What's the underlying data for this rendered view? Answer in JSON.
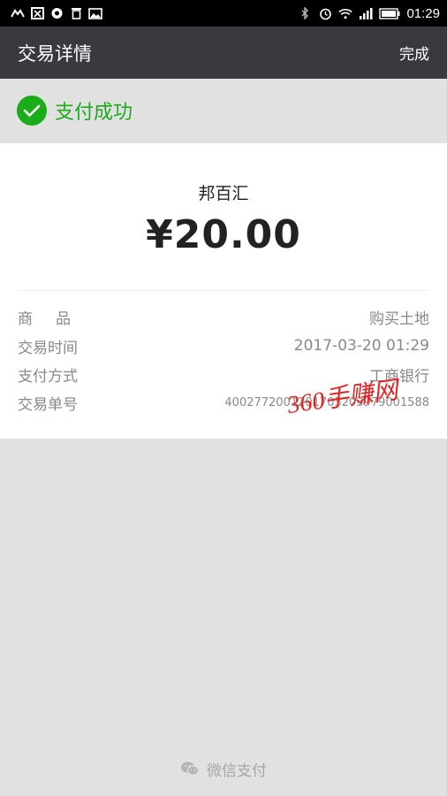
{
  "status_bar": {
    "time": "01:29",
    "left_icons": [
      "missed-call-icon",
      "image-x-icon",
      "chat-bubble-icon",
      "trash-icon",
      "gallery-icon"
    ],
    "right_icons": [
      "bluetooth-icon",
      "alarm-icon",
      "wifi-icon",
      "signal-icon",
      "battery-icon"
    ]
  },
  "toolbar": {
    "title": "交易详情",
    "done_label": "完成"
  },
  "payment_status": {
    "text": "支付成功",
    "color": "#1aad19"
  },
  "transaction": {
    "merchant": "邦百汇",
    "amount": "¥20.00",
    "details": [
      {
        "label": "商品",
        "value": "购买土地"
      },
      {
        "label": "交易时间",
        "value": "2017-03-20 01:29"
      },
      {
        "label": "支付方式",
        "value": "工商银行"
      },
      {
        "label": "交易单号",
        "value": "4002772001201703203979001588"
      }
    ]
  },
  "watermark": "360手赚网",
  "footer": {
    "brand": "微信支付"
  },
  "colors": {
    "toolbar_bg": "#393a3f",
    "page_bg": "#e1e1e1",
    "success_green": "#1aad19"
  }
}
